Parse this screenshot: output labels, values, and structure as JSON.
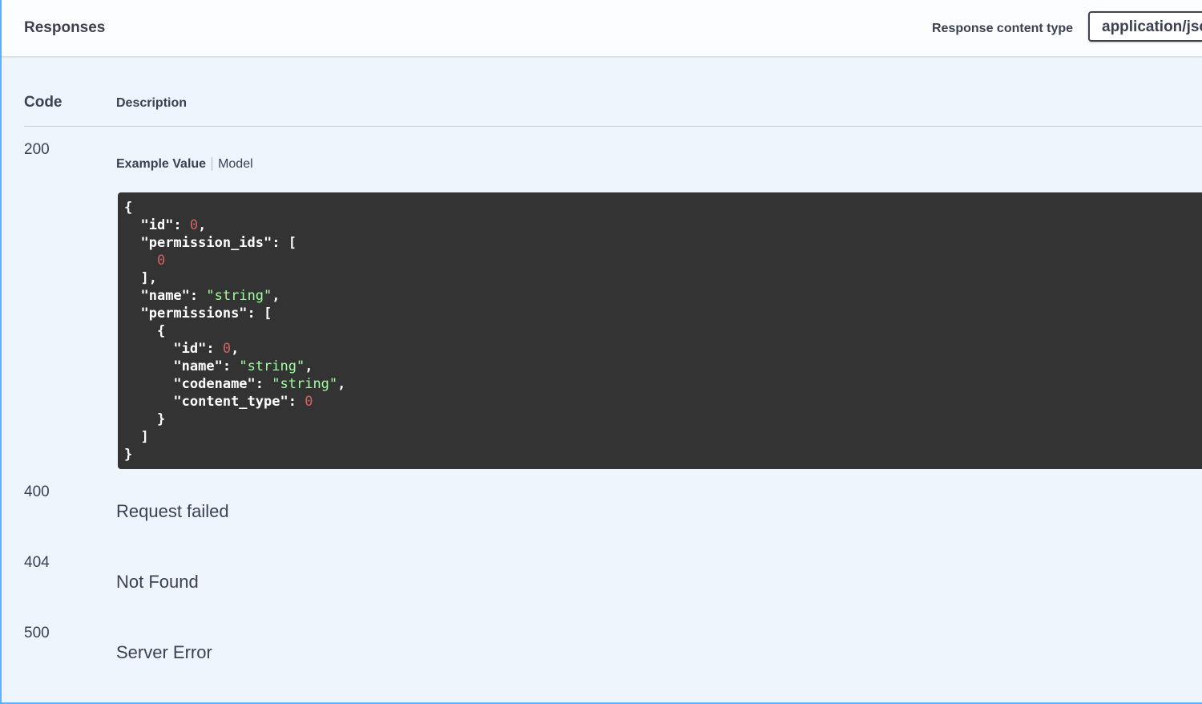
{
  "header": {
    "title": "Responses",
    "content_type_label": "Response content type",
    "content_type_value": "application/json"
  },
  "table": {
    "code_heading": "Code",
    "description_heading": "Description"
  },
  "responses": [
    {
      "code": "200",
      "tabs": [
        "Example Value",
        "Model"
      ],
      "example_lines": [
        "{",
        "  \"id\": 0,",
        "  \"permission_ids\": [",
        "    0",
        "  ],",
        "  \"name\": \"string\",",
        "  \"permissions\": [",
        "    {",
        "      \"id\": 0,",
        "      \"name\": \"string\",",
        "      \"codename\": \"string\",",
        "      \"content_type\": 0",
        "    }",
        "  ]",
        "}"
      ]
    },
    {
      "code": "400",
      "description": "Request failed"
    },
    {
      "code": "404",
      "description": "Not Found"
    },
    {
      "code": "500",
      "description": "Server Error"
    }
  ],
  "colors": {
    "border_accent": "#61affe",
    "panel_bg": "#eef5fc",
    "code_bg": "#333333",
    "json_number": "#d36363",
    "json_string": "#a2fca2"
  }
}
